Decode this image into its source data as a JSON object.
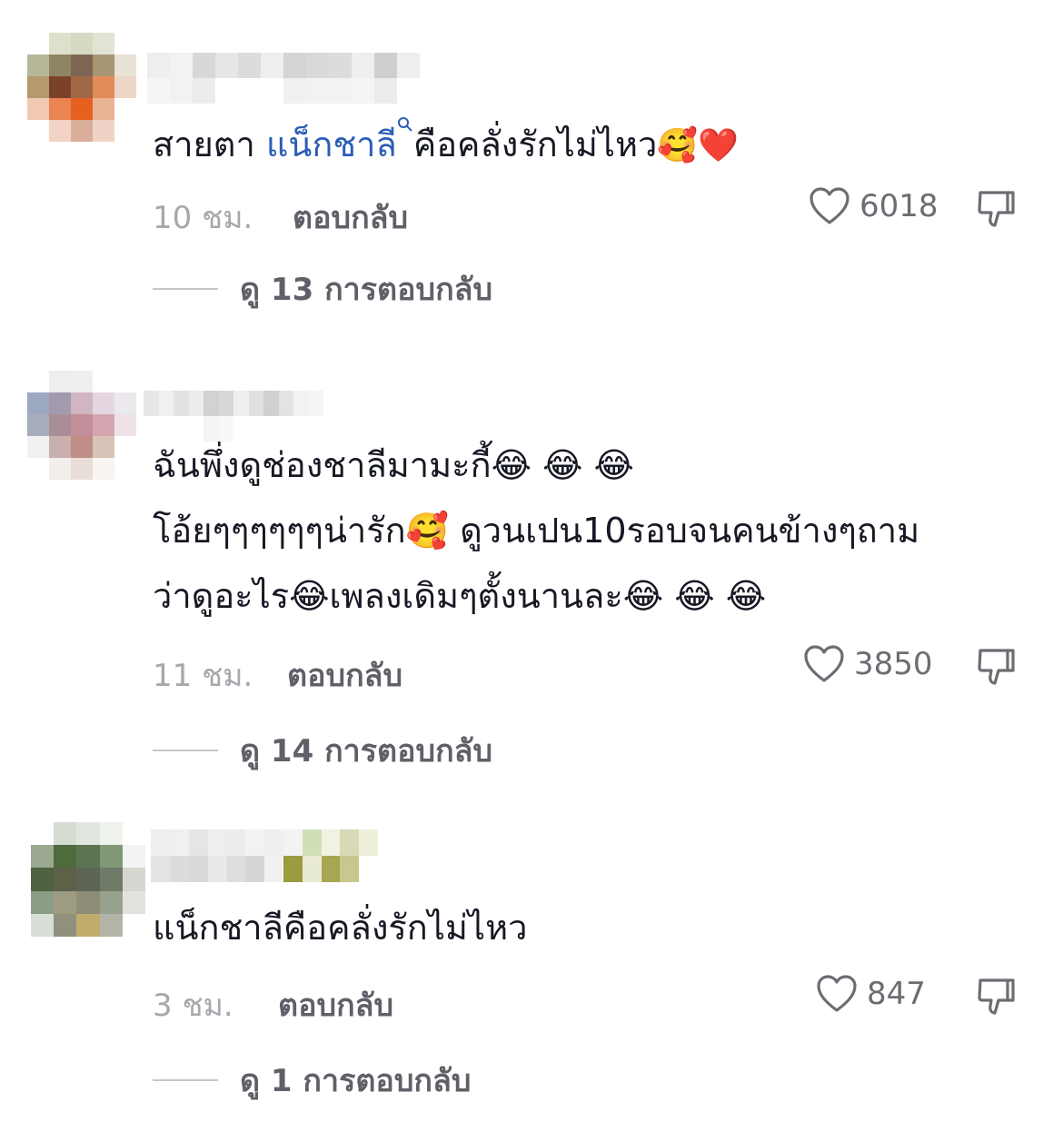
{
  "comments": [
    {
      "text_before": "สายตา ",
      "mention": "แน็กชาลี",
      "search_icon": "search-icon",
      "text_after": "คือคลั่งรักไม่ไหว",
      "emoji_1": "🥰",
      "emoji_2": "❤️",
      "time": "10 ชม.",
      "reply_label": "ตอบกลับ",
      "likes": "6018",
      "view_replies": "ดู 13 การตอบกลับ"
    },
    {
      "line1": "ฉันพึ่งดูช่องชาลีมามะกี้😂 😂 😂",
      "line2": "โอ้ยๆๆๆๆๆๆน่ารัก🥰 ดูวนเปน10รอบจนคนข้างๆถาม",
      "line3": "ว่าดูอะไร😂เพลงเดิมๆตั้งนานละ😂 😂 😂",
      "time": "11 ชม.",
      "reply_label": "ตอบกลับ",
      "likes": "3850",
      "view_replies": "ดู 14 การตอบกลับ"
    },
    {
      "text": "แน็กชาลีคือคลั่งรักไม่ไหว",
      "time": "3 ชม.",
      "reply_label": "ตอบกลับ",
      "likes": "847",
      "view_replies": "ดู 1 การตอบกลับ"
    }
  ],
  "colors": {
    "mention": "#2b5db6",
    "muted": "#a7a8ad",
    "reply": "#5f6068"
  },
  "icons": [
    "heart-outline-icon",
    "dislike-icon",
    "search-icon"
  ]
}
